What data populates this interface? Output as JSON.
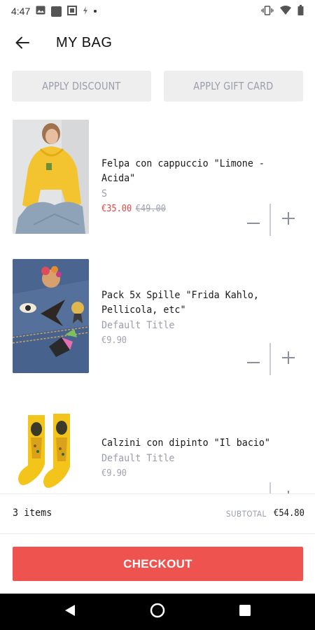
{
  "status_bar": {
    "time": "4:47",
    "left_icons": [
      "image-icon",
      "square-icon",
      "boxed-app-icon",
      "lightning-icon",
      "dot-icon"
    ],
    "right_icons": [
      "vibrate-icon",
      "wifi-icon",
      "battery-icon"
    ]
  },
  "header": {
    "back_icon": "arrow-left-icon",
    "title": "MY BAG"
  },
  "actions": {
    "discount_label": "APPLY DISCOUNT",
    "gift_card_label": "APPLY GIFT CARD"
  },
  "items": [
    {
      "name": "Felpa con cappuccio \"Limone - Acida\"",
      "variant": "S",
      "price": "€35.00",
      "compare_price": "€49.00",
      "on_sale": true,
      "image_desc_icon": "yellow-hoodie-photo"
    },
    {
      "name": "Pack 5x Spille \"Frida Kahlo, Pellicola, etc\"",
      "variant": "Default Title",
      "price": "€9.90",
      "on_sale": false,
      "image_desc_icon": "pins-on-denim-photo"
    },
    {
      "name": "Calzini con dipinto \"Il bacio\"",
      "variant": "Default Title",
      "price": "€9.90",
      "on_sale": false,
      "image_desc_icon": "yellow-socks-photo"
    }
  ],
  "quantity_controls": {
    "minus_icon": "minus-icon",
    "plus_icon": "plus-icon"
  },
  "summary": {
    "items_count": "3 items",
    "subtotal_label": "SUBTOTAL",
    "subtotal_value": "€54.80"
  },
  "checkout": {
    "label": "CHECKOUT"
  },
  "nav_bar": {
    "icons": [
      "nav-back-icon",
      "nav-home-icon",
      "nav-recents-icon"
    ]
  },
  "colors": {
    "accent": "#ef5350",
    "sale_price": "#e04545",
    "muted_text": "#9a9db0",
    "button_bg": "#eeeeef"
  }
}
